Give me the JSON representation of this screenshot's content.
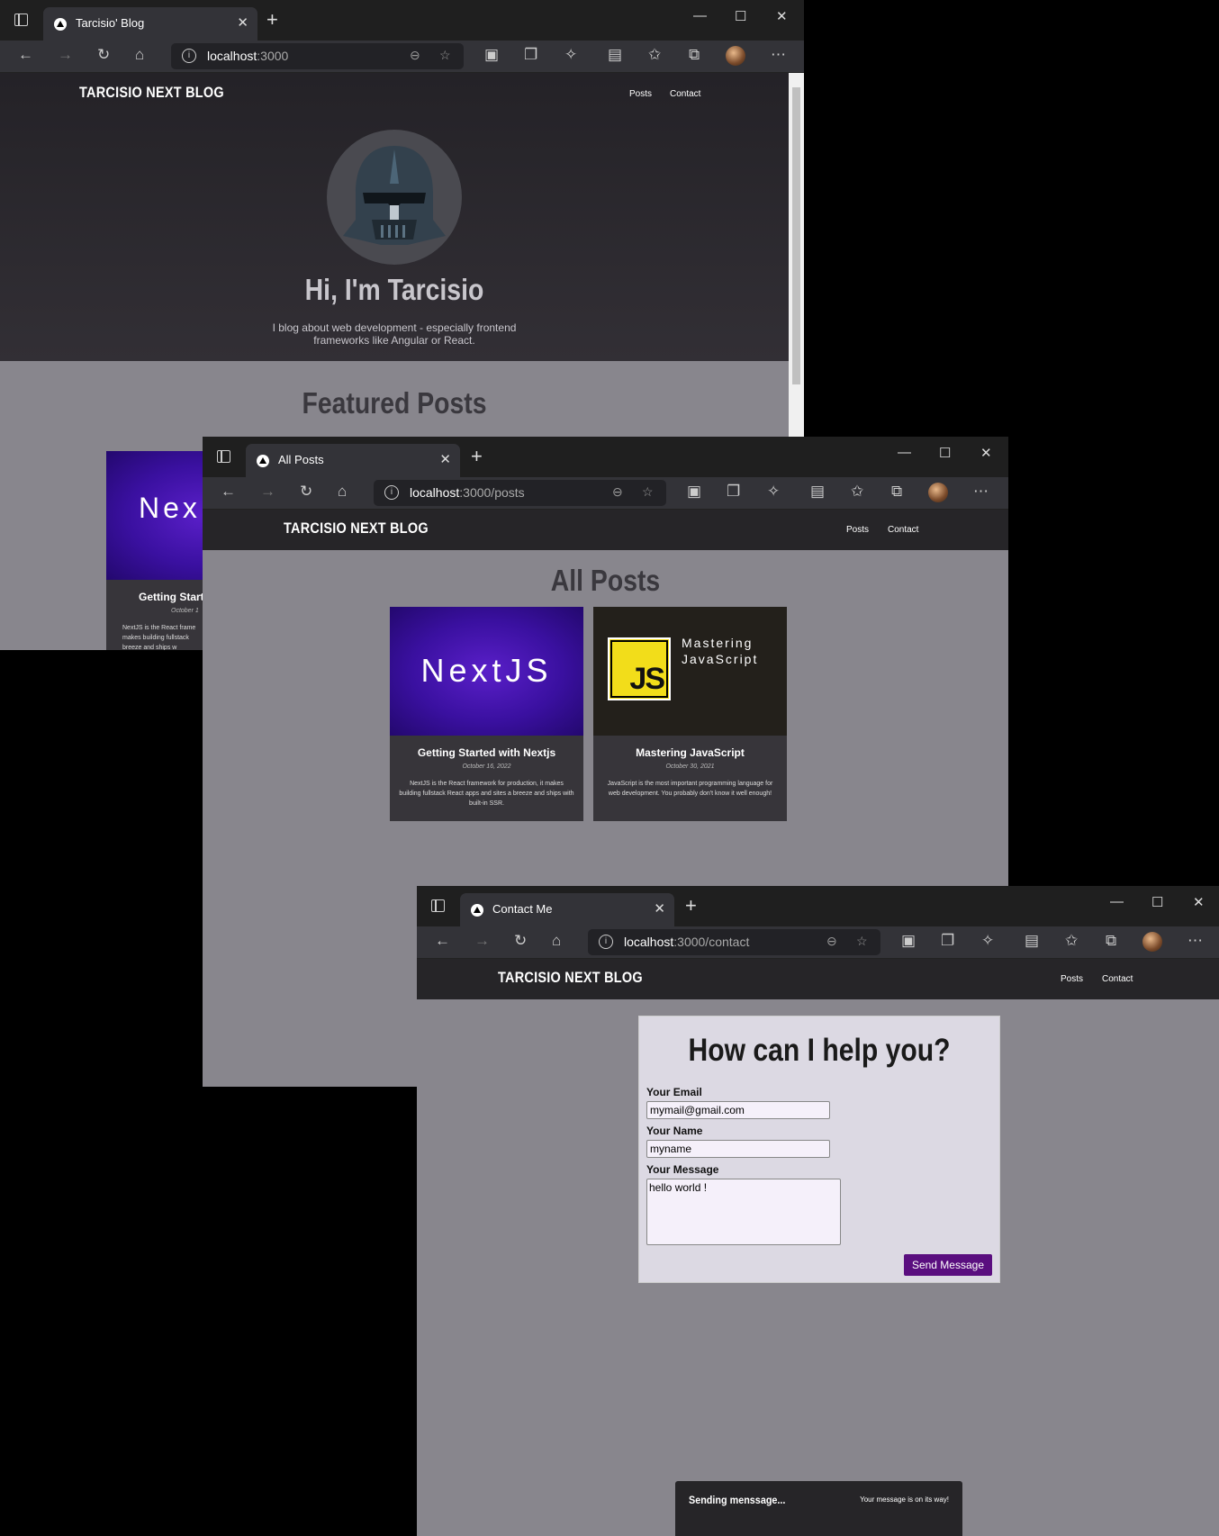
{
  "window1": {
    "tab_title": "Tarcisio' Blog",
    "url_host": "localhost",
    "url_path": ":3000",
    "logo": "TARCISIO NEXT BLOG",
    "nav": [
      "Posts",
      "Contact"
    ],
    "hero_title": "Hi, I'm Tarcisio",
    "hero_text_1": "I blog about web development - especially frontend",
    "hero_text_2": "frameworks like Angular or React.",
    "featured_title": "Featured Posts",
    "card": {
      "image_text": "Nex",
      "title": "Getting Starte",
      "date": "October 1",
      "excerpt": "NextJS is the React frame makes building fullstack breeze and ships w"
    }
  },
  "window2": {
    "tab_title": "All Posts",
    "url_host": "localhost",
    "url_path": ":3000/posts",
    "logo": "TARCISIO NEXT BLOG",
    "nav": [
      "Posts",
      "Contact"
    ],
    "page_title": "All Posts",
    "posts": [
      {
        "image_text": "NextJS",
        "title": "Getting Started with Nextjs",
        "date": "October 16, 2022",
        "excerpt": "NextJS is the React framework for production, it makes building fullstack React apps and sites a breeze and ships with built-in SSR."
      },
      {
        "image_badge": "JS",
        "image_text_1": "Mastering",
        "image_text_2": "JavaScript",
        "title": "Mastering JavaScript",
        "date": "October 30, 2021",
        "excerpt": "JavaScript is the most important programming language for web development. You probably don't know it well enough!"
      }
    ]
  },
  "window3": {
    "tab_title": "Contact Me",
    "url_host": "localhost",
    "url_path": ":3000/contact",
    "logo": "TARCISIO NEXT BLOG",
    "nav": [
      "Posts",
      "Contact"
    ],
    "form": {
      "heading": "How can I help you?",
      "email_label": "Your Email",
      "email_value": "mymail@gmail.com",
      "name_label": "Your Name",
      "name_value": "myname",
      "message_label": "Your Message",
      "message_value": "hello world !",
      "submit": "Send Message"
    },
    "notification": {
      "title": "Sending menssage...",
      "message": "Your message is on its way!"
    }
  },
  "colors": {
    "chrome_dark": "#1f1f1f",
    "toolbar": "#333338",
    "nav_bg": "#262528",
    "page_bg": "#88868d",
    "accent_purple": "#5a0e7f",
    "js_yellow": "#f2dd1a"
  }
}
